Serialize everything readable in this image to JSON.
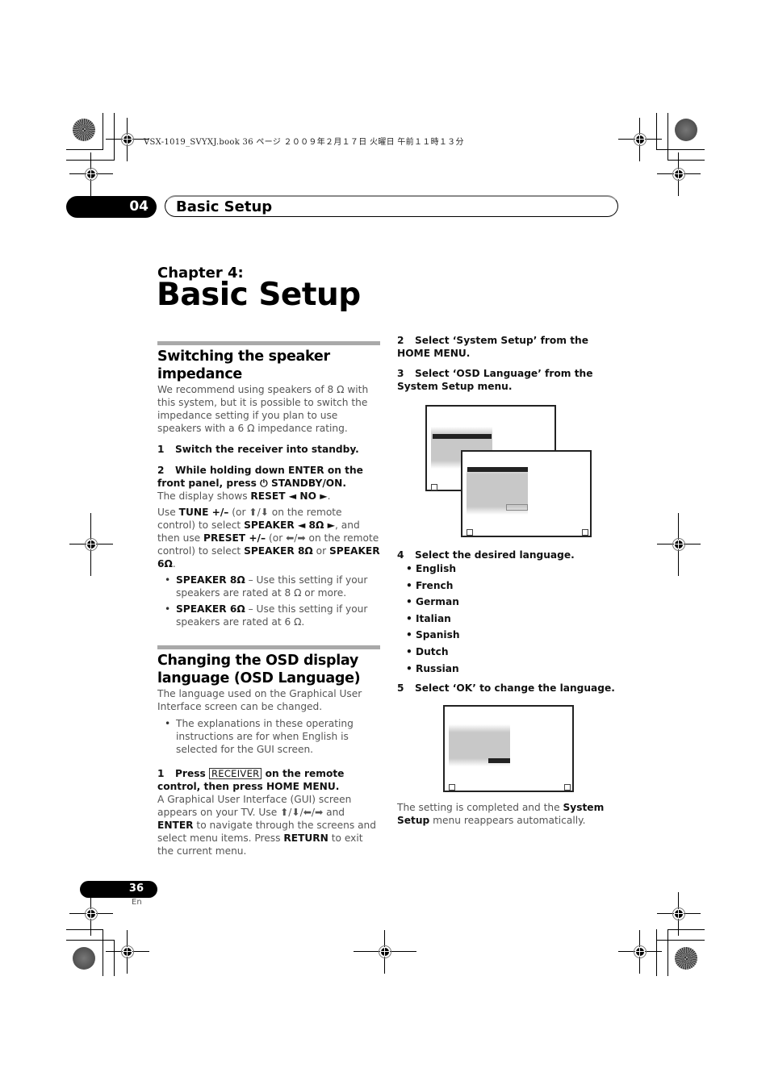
{
  "print_header": {
    "book_line": "VSX-1019_SVYXJ.book  36 ページ  ２００９年２月１７日  火曜日  午前１１時１３分"
  },
  "chapter_band": {
    "number": "04",
    "title": "Basic Setup"
  },
  "chapter": {
    "label": "Chapter 4:",
    "title": "Basic Setup"
  },
  "section_impedance": {
    "heading": "Switching the speaker impedance",
    "intro": "We recommend using speakers of 8 Ω with this system, but it is possible to switch the impedance setting if you plan to use speakers with a 6 Ω impedance rating.",
    "step1": {
      "num": "1",
      "text": "Switch the receiver into standby."
    },
    "step2": {
      "num": "2",
      "text": "While holding down ENTER on the front panel, press ⏻ STANDBY/ON."
    },
    "display_shows": {
      "pre": "The display shows ",
      "bold": "RESET ◄ NO ►",
      "post": "."
    },
    "use_text": {
      "a": "Use ",
      "b1": "TUNE +/–",
      "c": " (or ⬆/⬇ on the remote control) to select ",
      "b2": "SPEAKER ◄ 8Ω ►",
      "d": ", and then use ",
      "b3": "PRESET +/–",
      "e": " (or ⬅/➡ on the remote control) to select ",
      "b4": "SPEAKER 8Ω",
      "f": " or ",
      "b5": "SPEAKER 6Ω",
      "g": "."
    },
    "bullets": [
      {
        "bold": "SPEAKER 8Ω",
        "text": " – Use this setting if your speakers are rated at 8 Ω or more."
      },
      {
        "bold": "SPEAKER 6Ω",
        "text": " – Use this setting if your speakers are rated at 6 Ω."
      }
    ]
  },
  "section_osd": {
    "heading": "Changing the OSD display language (OSD Language)",
    "intro": "The language used on the Graphical User Interface screen can be changed.",
    "note": "The explanations in these operating instructions are for when English is selected for the GUI screen.",
    "step1": {
      "num": "1",
      "pre": "Press ",
      "key": "RECEIVER",
      "post": " on the remote control, then press HOME MENU."
    },
    "step1_body": {
      "a": "A Graphical User Interface (GUI) screen appears on your TV. Use ⬆/⬇/⬅/➡ and ",
      "b1": "ENTER",
      "c": " to navigate through the screens and select menu items. Press ",
      "b2": "RETURN",
      "d": " to exit the current menu."
    },
    "step2": {
      "num": "2",
      "text": "Select ‘System Setup’ from the HOME MENU."
    },
    "step3": {
      "num": "3",
      "text": "Select ‘OSD Language’ from the System Setup menu."
    },
    "step4": {
      "num": "4",
      "text": "Select the desired language."
    },
    "languages": [
      "English",
      "French",
      "German",
      "Italian",
      "Spanish",
      "Dutch",
      "Russian"
    ],
    "step5": {
      "num": "5",
      "text": "Select ‘OK’ to change the language."
    },
    "completion": {
      "pre": "The setting is completed and the ",
      "bold": "System Setup",
      "post": " menu reappears automatically."
    }
  },
  "footer": {
    "page_number": "36",
    "language": "En"
  }
}
